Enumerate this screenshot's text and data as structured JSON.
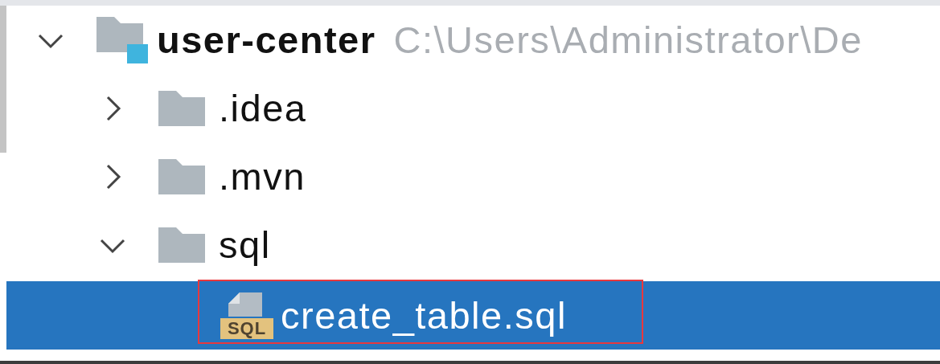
{
  "tree": [
    {
      "kind": "module",
      "label": "user-center",
      "path": "C:\\Users\\Administrator\\De",
      "expanded": true,
      "selected": false,
      "children": [
        {
          "kind": "folder",
          "label": ".idea",
          "expanded": false,
          "selected": false
        },
        {
          "kind": "folder",
          "label": ".mvn",
          "expanded": false,
          "selected": false
        },
        {
          "kind": "folder",
          "label": "sql",
          "expanded": true,
          "selected": false,
          "children": [
            {
              "kind": "sql_file",
              "label": "create_table.sql",
              "badge": "SQL",
              "selected": true,
              "highlighted": true
            }
          ]
        }
      ]
    }
  ]
}
